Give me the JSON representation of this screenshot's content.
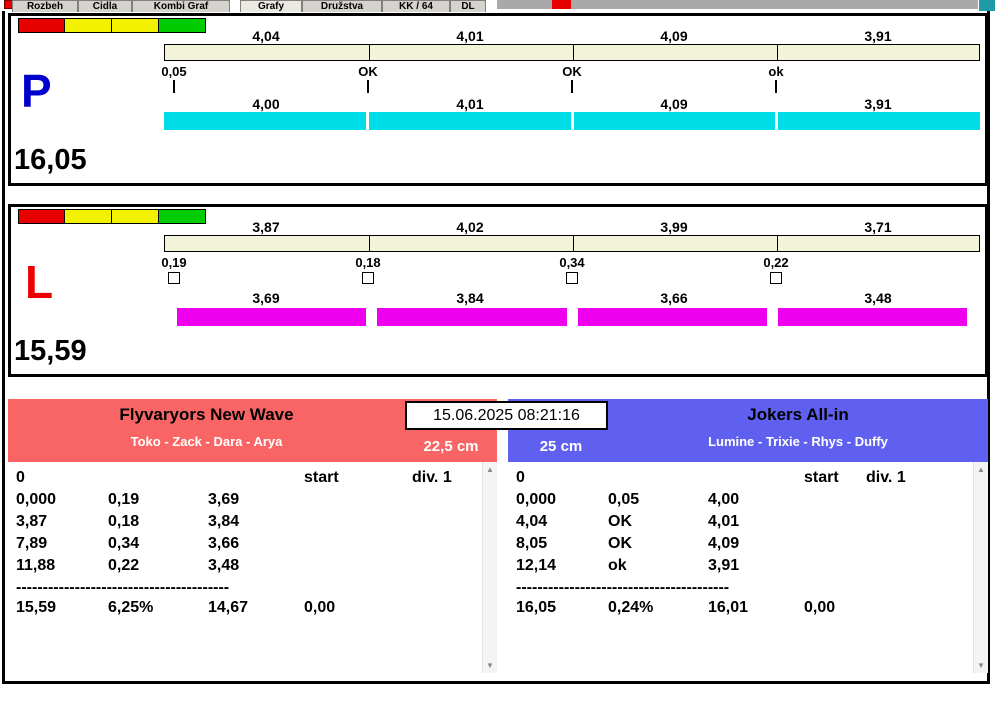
{
  "tabs": {
    "items": [
      "Rozbeh",
      "Cidla",
      "Kombi Graf",
      "Grafy",
      "Družstva",
      "KK / 64",
      "DL"
    ],
    "selected": "Grafy"
  },
  "lanes": {
    "p": {
      "label": "P",
      "total": "16,05",
      "top_values": [
        "4,04",
        "4,01",
        "4,09",
        "3,91"
      ],
      "mid_labels": [
        "0,05",
        "OK",
        "OK",
        "ok"
      ],
      "bottom_values": [
        "4,00",
        "4,01",
        "4,09",
        "3,91"
      ],
      "bar_color": "#00dde6",
      "label_color": "#0000cc"
    },
    "l": {
      "label": "L",
      "total": "15,59",
      "top_values": [
        "3,87",
        "4,02",
        "3,99",
        "3,71"
      ],
      "mid_labels": [
        "0,19",
        "0,18",
        "0,34",
        "0,22"
      ],
      "bottom_values": [
        "3,69",
        "3,84",
        "3,66",
        "3,48"
      ],
      "bar_color": "#ee00ee",
      "label_color": "#ee0000"
    }
  },
  "timestamp": "15.06.2025 08:21:16",
  "teams": {
    "left": {
      "name": "Flyvaryors New Wave",
      "members": "Toko - Zack - Dara - Arya",
      "distance": "22,5 cm",
      "color": "#f96565"
    },
    "right": {
      "name": "Jokers All-in",
      "members": "Lumine - Trixie - Rhys - Duffy",
      "distance": "25 cm",
      "color": "#6060f0"
    }
  },
  "results": {
    "left": {
      "header": [
        "0",
        "start",
        "div. 1"
      ],
      "rows": [
        [
          "0,000",
          "0,19",
          "3,69"
        ],
        [
          "3,87",
          "0,18",
          "3,84"
        ],
        [
          "7,89",
          "0,34",
          "3,66"
        ],
        [
          "11,88",
          "0,22",
          "3,48"
        ]
      ],
      "separator": "----------------------------------------",
      "totals": [
        "15,59",
        "6,25%",
        "14,67",
        "0,00"
      ]
    },
    "right": {
      "header": [
        "0",
        "start",
        "div. 1"
      ],
      "rows": [
        [
          "0,000",
          "0,05",
          "4,00"
        ],
        [
          "4,04",
          "OK",
          "4,01"
        ],
        [
          "8,05",
          "OK",
          "4,09"
        ],
        [
          "12,14",
          "ok",
          "3,91"
        ]
      ],
      "separator": "----------------------------------------",
      "totals": [
        "16,05",
        "0,24%",
        "16,01",
        "0,00"
      ]
    }
  },
  "icons": {
    "scroll_up": "▲",
    "scroll_down": "▼"
  }
}
